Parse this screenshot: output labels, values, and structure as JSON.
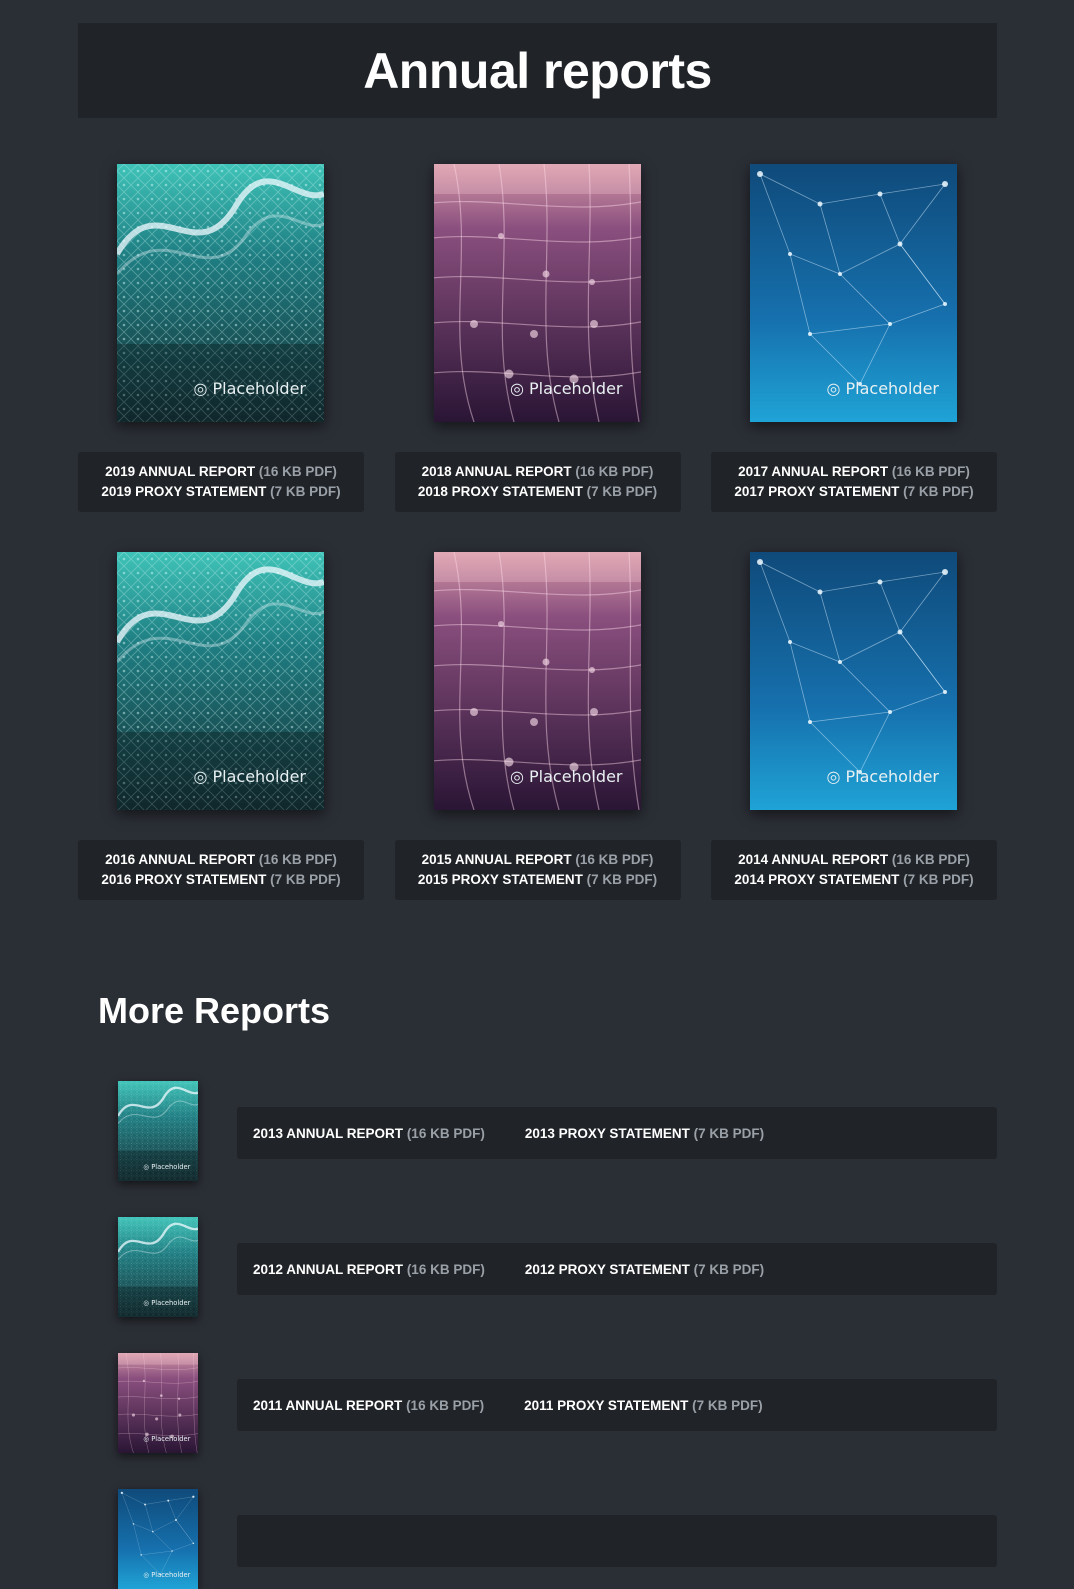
{
  "header": {
    "title": "Annual reports"
  },
  "cover_brand": "Placeholder",
  "colors": {
    "background": "#2a2e35",
    "panel": "#202327",
    "muted": "#9aa0a8",
    "teal": "#1f7f83",
    "purple": "#5a2f66",
    "blue": "#1a78b8"
  },
  "reports": [
    {
      "annual": "2019 ANNUAL REPORT",
      "annual_size": "(16 KB PDF)",
      "proxy": "2019 PROXY STATEMENT",
      "proxy_size": "(7 KB PDF)",
      "cover": "teal-wave"
    },
    {
      "annual": "2018 ANNUAL REPORT",
      "annual_size": "(16 KB PDF)",
      "proxy": "2018 PROXY STATEMENT",
      "proxy_size": "(7 KB PDF)",
      "cover": "purple-mesh"
    },
    {
      "annual": "2017 ANNUAL REPORT",
      "annual_size": "(16 KB PDF)",
      "proxy": "2017 PROXY STATEMENT",
      "proxy_size": "(7 KB PDF)",
      "cover": "blue-network"
    },
    {
      "annual": "2016 ANNUAL REPORT",
      "annual_size": "(16 KB PDF)",
      "proxy": "2016 PROXY STATEMENT",
      "proxy_size": "(7 KB PDF)",
      "cover": "teal-wave"
    },
    {
      "annual": "2015 ANNUAL REPORT",
      "annual_size": "(16 KB PDF)",
      "proxy": "2015 PROXY STATEMENT",
      "proxy_size": "(7 KB PDF)",
      "cover": "purple-mesh"
    },
    {
      "annual": "2014 ANNUAL REPORT",
      "annual_size": "(16 KB PDF)",
      "proxy": "2014 PROXY STATEMENT",
      "proxy_size": "(7 KB PDF)",
      "cover": "blue-network"
    }
  ],
  "more": {
    "title": "More Reports",
    "items": [
      {
        "annual": "2013 ANNUAL REPORT",
        "annual_size": "(16 KB PDF)",
        "proxy": "2013 PROXY STATEMENT",
        "proxy_size": "(7 KB PDF)",
        "cover": "teal-wave"
      },
      {
        "annual": "2012 ANNUAL REPORT",
        "annual_size": "(16 KB PDF)",
        "proxy": "2012 PROXY STATEMENT",
        "proxy_size": "(7 KB PDF)",
        "cover": "teal-wave"
      },
      {
        "annual": "2011 ANNUAL REPORT",
        "annual_size": "(16 KB PDF)",
        "proxy": "2011 PROXY STATEMENT",
        "proxy_size": "(7 KB PDF)",
        "cover": "purple-mesh"
      },
      {
        "annual": "",
        "annual_size": "",
        "proxy": "",
        "proxy_size": "",
        "cover": "blue-network"
      }
    ]
  }
}
